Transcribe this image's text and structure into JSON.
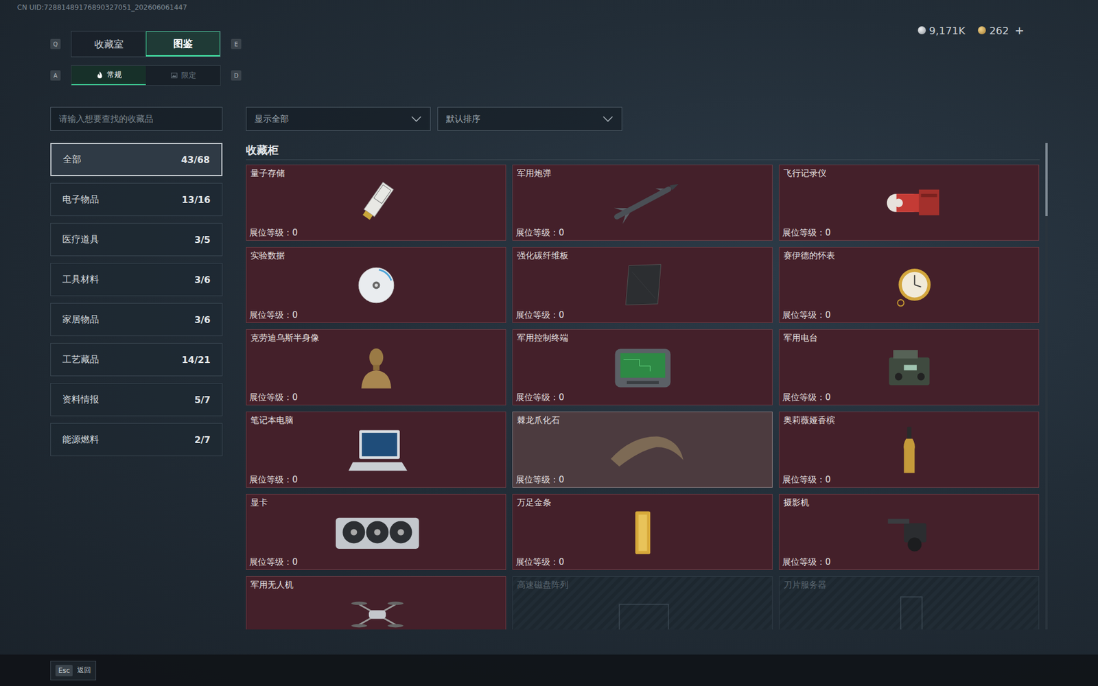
{
  "uid": "CN UID:72881489176890327051_202606061447",
  "top_tabs": {
    "prev_key": "Q",
    "next_key": "E",
    "items": [
      {
        "label": "收藏室",
        "selected": false
      },
      {
        "label": "图鉴",
        "selected": true
      }
    ]
  },
  "sub_tabs": {
    "prev_key": "A",
    "next_key": "D",
    "items": [
      {
        "label": "常规",
        "selected": true,
        "kind": "flame"
      },
      {
        "label": "限定",
        "selected": false,
        "kind": "picture"
      }
    ]
  },
  "currency": [
    {
      "amount": "9,171K",
      "kind": "silver"
    },
    {
      "amount": "262",
      "kind": "gold"
    }
  ],
  "add_button": "+",
  "search": {
    "placeholder": "请输入想要查找的收藏品"
  },
  "filters": [
    {
      "value": "显示全部"
    },
    {
      "value": "默认排序"
    }
  ],
  "categories": [
    {
      "label": "全部",
      "count": "43/68",
      "selected": true
    },
    {
      "label": "电子物品",
      "count": "13/16",
      "selected": false
    },
    {
      "label": "医疗道具",
      "count": "3/5",
      "selected": false
    },
    {
      "label": "工具材料",
      "count": "3/6",
      "selected": false
    },
    {
      "label": "家居物品",
      "count": "3/6",
      "selected": false
    },
    {
      "label": "工艺藏品",
      "count": "14/21",
      "selected": false
    },
    {
      "label": "资料情报",
      "count": "5/7",
      "selected": false
    },
    {
      "label": "能源燃料",
      "count": "2/7",
      "selected": false
    }
  ],
  "section_title": "收藏柜",
  "items": [
    {
      "name": "量子存储",
      "kind": "drive",
      "collected": true,
      "highlighted": false,
      "booth": "展位等级：0"
    },
    {
      "name": "军用炮弹",
      "kind": "missile",
      "collected": true,
      "highlighted": false,
      "booth": "展位等级：0"
    },
    {
      "name": "飞行记录仪",
      "kind": "recorder",
      "collected": true,
      "highlighted": false,
      "booth": "展位等级：0"
    },
    {
      "name": "实验数据",
      "kind": "disc",
      "collected": true,
      "highlighted": false,
      "booth": "展位等级：0"
    },
    {
      "name": "强化碳纤维板",
      "kind": "panel",
      "collected": true,
      "highlighted": false,
      "booth": "展位等级：0"
    },
    {
      "name": "赛伊德的怀表",
      "kind": "watch",
      "collected": true,
      "highlighted": false,
      "booth": "展位等级：0"
    },
    {
      "name": "克劳迪乌斯半身像",
      "kind": "bust",
      "collected": true,
      "highlighted": false,
      "booth": "展位等级：0"
    },
    {
      "name": "军用控制终端",
      "kind": "terminal",
      "collected": true,
      "highlighted": false,
      "booth": "展位等级：0"
    },
    {
      "name": "军用电台",
      "kind": "radio",
      "collected": true,
      "highlighted": false,
      "booth": "展位等级：0"
    },
    {
      "name": "笔记本电脑",
      "kind": "laptop",
      "collected": true,
      "highlighted": false,
      "booth": "展位等级：0"
    },
    {
      "name": "棘龙爪化石",
      "kind": "claw",
      "collected": true,
      "highlighted": true,
      "booth": "展位等级：0"
    },
    {
      "name": "奥莉薇娅香槟",
      "kind": "bottle",
      "collected": true,
      "highlighted": false,
      "booth": "展位等级：0"
    },
    {
      "name": "显卡",
      "kind": "gpu",
      "collected": true,
      "highlighted": false,
      "booth": "展位等级：0"
    },
    {
      "name": "万足金条",
      "kind": "goldbar",
      "collected": true,
      "highlighted": false,
      "booth": "展位等级：0"
    },
    {
      "name": "摄影机",
      "kind": "camera",
      "collected": true,
      "highlighted": false,
      "booth": "展位等级：0"
    },
    {
      "name": "军用无人机",
      "kind": "drone",
      "collected": true,
      "highlighted": false
    },
    {
      "name": "高速磁盘阵列",
      "kind": "array",
      "collected": false,
      "highlighted": false
    },
    {
      "name": "刀片服务器",
      "kind": "server",
      "collected": false,
      "highlighted": false
    }
  ],
  "scrollbar": {
    "level": 0.15
  },
  "footer": {
    "key": "Esc",
    "label": "返回"
  }
}
